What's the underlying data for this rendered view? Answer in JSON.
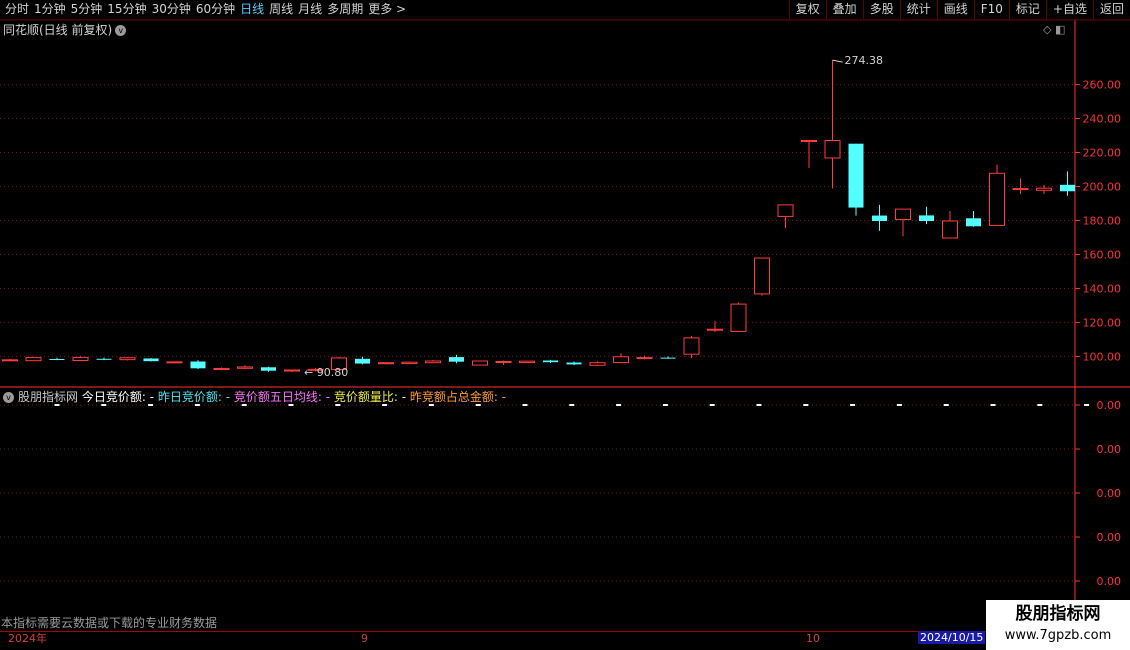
{
  "toolbar": {
    "periods": [
      "分时",
      "1分钟",
      "5分钟",
      "15分钟",
      "30分钟",
      "60分钟",
      "日线",
      "周线",
      "月线",
      "多周期",
      "更多 >"
    ],
    "active_period": "日线",
    "right_buttons": [
      "复权",
      "叠加",
      "多股",
      "统计",
      "画线",
      "F10",
      "标记",
      "+自选",
      "返回"
    ]
  },
  "main_panel": {
    "title": "同花顺(日线 前复权)",
    "corner_icons": "◇ ◧"
  },
  "indicator_panel": {
    "chevron": "v",
    "name": "股朋指标网",
    "items": [
      {
        "label": "今日竞价额: -",
        "color": "#ffffff"
      },
      {
        "label": "昨日竞价额: -",
        "color": "#4fe0f0"
      },
      {
        "label": "竞价额五日均线: -",
        "color": "#ff70ff"
      },
      {
        "label": "竞价额量比: -",
        "color": "#f0f040"
      },
      {
        "label": "昨竞额占总金额: -",
        "color": "#ff9a30"
      }
    ]
  },
  "footer_note": "本指标需要云数据或下载的专业财务数据",
  "date_axis": {
    "labels": [
      "2024年",
      "9",
      "10"
    ],
    "highlight": "2024/10/15"
  },
  "watermark": {
    "line1": "股朋指标网",
    "line2": "www.7gpzb.com"
  },
  "colors": {
    "up": "#ff3c3c",
    "down": "#54ffff",
    "grid": "#7a1010",
    "axis": "#ff3030"
  },
  "chart_data": [
    {
      "type": "candlestick",
      "title": "同花顺(日线 前复权)",
      "yticks": [
        100,
        120,
        140,
        160,
        180,
        200,
        220,
        240,
        260
      ],
      "ytick_labels": [
        "100.00",
        "120.00",
        "140.00",
        "160.00",
        "180.00",
        "200.00",
        "220.00",
        "240.00",
        "260.00"
      ],
      "ylim": [
        82,
        288
      ],
      "annotations": [
        {
          "text": "274.38",
          "value": 274.38,
          "candle_index": 35
        },
        {
          "text": "← 90.80",
          "value": 90.8,
          "candle_index": 12
        }
      ],
      "candles": [
        {
          "o": 98.0,
          "h": 98.5,
          "l": 97.5,
          "c": 98.0
        },
        {
          "o": 97.5,
          "h": 99.8,
          "l": 97.3,
          "c": 99.3
        },
        {
          "o": 98.5,
          "h": 99.2,
          "l": 97.8,
          "c": 98.0
        },
        {
          "o": 97.6,
          "h": 100.0,
          "l": 97.4,
          "c": 99.4
        },
        {
          "o": 98.6,
          "h": 99.2,
          "l": 97.8,
          "c": 98.1
        },
        {
          "o": 98.1,
          "h": 99.5,
          "l": 97.7,
          "c": 99.2
        },
        {
          "o": 98.8,
          "h": 99.0,
          "l": 97.0,
          "c": 97.2
        },
        {
          "o": 96.5,
          "h": 97.0,
          "l": 95.8,
          "c": 96.8
        },
        {
          "o": 97.0,
          "h": 97.8,
          "l": 92.6,
          "c": 93.0
        },
        {
          "o": 92.6,
          "h": 93.5,
          "l": 91.8,
          "c": 92.9
        },
        {
          "o": 93.0,
          "h": 94.8,
          "l": 92.6,
          "c": 93.8
        },
        {
          "o": 93.6,
          "h": 93.9,
          "l": 91.0,
          "c": 91.6
        },
        {
          "o": 91.6,
          "h": 92.2,
          "l": 90.8,
          "c": 92.0
        },
        {
          "o": 91.8,
          "h": 93.2,
          "l": 91.2,
          "c": 92.4
        },
        {
          "o": 92.3,
          "h": 99.8,
          "l": 92.0,
          "c": 99.1
        },
        {
          "o": 98.6,
          "h": 99.8,
          "l": 95.3,
          "c": 95.8
        },
        {
          "o": 95.8,
          "h": 96.6,
          "l": 95.3,
          "c": 96.3
        },
        {
          "o": 95.8,
          "h": 97.0,
          "l": 95.5,
          "c": 96.6
        },
        {
          "o": 96.3,
          "h": 97.9,
          "l": 96.0,
          "c": 97.3
        },
        {
          "o": 99.6,
          "h": 101.0,
          "l": 96.0,
          "c": 96.9
        },
        {
          "o": 94.9,
          "h": 97.6,
          "l": 94.7,
          "c": 97.3
        },
        {
          "o": 96.8,
          "h": 97.6,
          "l": 95.0,
          "c": 97.0
        },
        {
          "o": 96.4,
          "h": 97.5,
          "l": 96.1,
          "c": 97.2
        },
        {
          "o": 97.6,
          "h": 98.0,
          "l": 96.1,
          "c": 96.6
        },
        {
          "o": 96.4,
          "h": 97.0,
          "l": 94.9,
          "c": 95.3
        },
        {
          "o": 94.8,
          "h": 97.1,
          "l": 94.6,
          "c": 96.3
        },
        {
          "o": 96.4,
          "h": 101.9,
          "l": 96.1,
          "c": 99.8
        },
        {
          "o": 98.8,
          "h": 100.5,
          "l": 98.3,
          "c": 99.3
        },
        {
          "o": 99.3,
          "h": 100.0,
          "l": 98.6,
          "c": 98.9
        },
        {
          "o": 101.3,
          "h": 112.0,
          "l": 99.1,
          "c": 110.9
        },
        {
          "o": 115.4,
          "h": 120.9,
          "l": 114.4,
          "c": 116.0
        },
        {
          "o": 114.7,
          "h": 131.7,
          "l": 114.4,
          "c": 130.8
        },
        {
          "o": 136.8,
          "h": 157.9,
          "l": 135.8,
          "c": 157.9
        },
        {
          "o": 182.4,
          "h": 189.2,
          "l": 175.5,
          "c": 189.2
        },
        {
          "o": 227.1,
          "h": 227.1,
          "l": 210.9,
          "c": 227.1
        },
        {
          "o": 216.8,
          "h": 274.4,
          "l": 198.8,
          "c": 227.1
        },
        {
          "o": 225.2,
          "h": 225.2,
          "l": 182.9,
          "c": 187.6
        },
        {
          "o": 182.9,
          "h": 189.2,
          "l": 174.0,
          "c": 179.7
        },
        {
          "o": 180.6,
          "h": 186.7,
          "l": 170.7,
          "c": 186.7
        },
        {
          "o": 183.0,
          "h": 188.1,
          "l": 177.9,
          "c": 179.7
        },
        {
          "o": 169.7,
          "h": 185.6,
          "l": 169.7,
          "c": 179.7
        },
        {
          "o": 181.3,
          "h": 185.6,
          "l": 176.3,
          "c": 176.6
        },
        {
          "o": 177.1,
          "h": 212.9,
          "l": 177.1,
          "c": 207.8
        },
        {
          "o": 198.8,
          "h": 204.9,
          "l": 195.7,
          "c": 198.8
        },
        {
          "o": 197.8,
          "h": 201.0,
          "l": 195.7,
          "c": 199.0
        },
        {
          "o": 201.0,
          "h": 208.9,
          "l": 194.6,
          "c": 197.2
        }
      ]
    },
    {
      "type": "line",
      "title": "股朋指标网",
      "yticks": [
        0,
        0,
        0,
        0,
        0
      ],
      "ytick_labels": [
        "0.00",
        "0.00",
        "0.00",
        "0.00",
        "0.00"
      ],
      "series": [
        {
          "name": "今日竞价额",
          "values": [
            0,
            0,
            0,
            0,
            0,
            0,
            0,
            0,
            0,
            0,
            0,
            0,
            0,
            0,
            0,
            0,
            0,
            0,
            0,
            0,
            0,
            0,
            0
          ]
        }
      ]
    }
  ]
}
